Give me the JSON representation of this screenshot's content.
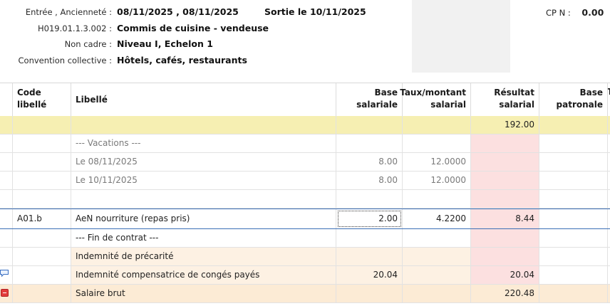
{
  "header": {
    "entree_label": "Entrée , Ancienneté :",
    "entree_value": "08/11/2025 ,  08/11/2025",
    "sortie_value": "Sortie le 10/11/2025",
    "job_code_label": "H019.01.1.3.002 :",
    "job_value": "Commis de cuisine - vendeuse",
    "status_label": "Non cadre :",
    "status_value": "Niveau I, Echelon 1",
    "convention_label": "Convention collective :",
    "convention_value": "Hôtels, cafés, restaurants",
    "cp_label": "CP N :",
    "cp_value": "0.00"
  },
  "table": {
    "columns": {
      "code": [
        "Code",
        "libellé"
      ],
      "libelle": "Libellé",
      "base_salariale": [
        "Base",
        "salariale"
      ],
      "taux_salarial": [
        "Taux/montant",
        "salarial"
      ],
      "resultat_salarial": [
        "Résultat",
        "salarial"
      ],
      "base_patronale": [
        "Base",
        "patronale"
      ],
      "next_truncated": "T"
    },
    "rows": [
      {
        "code": "",
        "libelle": "",
        "base": "",
        "taux": "",
        "resultat": "192.00"
      },
      {
        "code": "",
        "libelle": "--- Vacations ---",
        "base": "",
        "taux": "",
        "resultat": ""
      },
      {
        "code": "",
        "libelle": "Le 08/11/2025",
        "base": "8.00",
        "taux": "12.0000",
        "resultat": ""
      },
      {
        "code": "",
        "libelle": "Le 10/11/2025",
        "base": "8.00",
        "taux": "12.0000",
        "resultat": ""
      },
      {
        "code": "",
        "libelle": "",
        "base": "",
        "taux": "",
        "resultat": ""
      },
      {
        "code": "A01.b",
        "libelle": "AeN nourriture (repas pris)",
        "base": "2.00",
        "taux": "4.2200",
        "resultat": "8.44"
      },
      {
        "code": "",
        "libelle": "--- Fin de contrat ---",
        "base": "",
        "taux": "",
        "resultat": ""
      },
      {
        "code": "",
        "libelle": "Indemnité de précarité",
        "base": "",
        "taux": "",
        "resultat": ""
      },
      {
        "code": "",
        "libelle": "Indemnité compensatrice de congés payés",
        "base": "20.04",
        "taux": "",
        "resultat": "20.04"
      },
      {
        "code": "",
        "libelle": "Salaire brut",
        "base": "",
        "taux": "",
        "resultat": "220.48"
      }
    ]
  },
  "icons": {
    "comment": "speech-bubble-icon",
    "collapse": "minus-icon"
  },
  "colors": {
    "yellow_row": "#f6efb2",
    "brut_row": "#fcebd5",
    "result_pink": "#fce0e0",
    "selection": "#3b6fb6"
  }
}
